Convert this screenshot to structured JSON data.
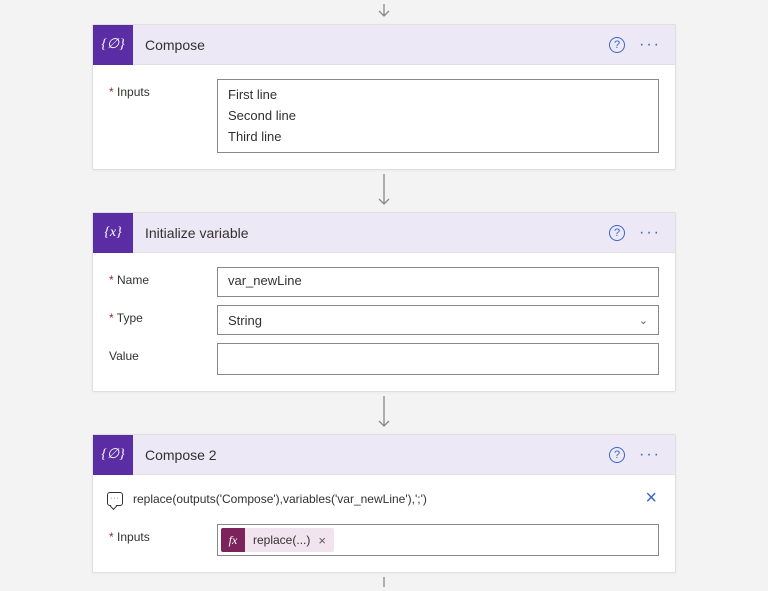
{
  "colors": {
    "accent": "#5b2da5",
    "headerBg": "#ede8f6",
    "link": "#3b66c7",
    "fxBadge": "#7c235b"
  },
  "actions": {
    "help": "?",
    "menu": "···"
  },
  "step1": {
    "iconGlyph": "{∅}",
    "title": "Compose",
    "inputsLabel": "Inputs",
    "inputsLines": [
      "First line",
      "Second line",
      "Third line"
    ]
  },
  "step2": {
    "iconGlyph": "{x}",
    "title": "Initialize variable",
    "nameLabel": "Name",
    "nameValue": "var_newLine",
    "typeLabel": "Type",
    "typeValue": "String",
    "valueLabel": "Value",
    "valueValue": ""
  },
  "step3": {
    "iconGlyph": "{∅}",
    "title": "Compose 2",
    "expression": "replace(outputs('Compose'),variables('var_newLine'),';')",
    "inputsLabel": "Inputs",
    "tokenFx": "fx",
    "tokenLabel": "replace(...)",
    "tokenRemove": "×",
    "close": "×"
  }
}
